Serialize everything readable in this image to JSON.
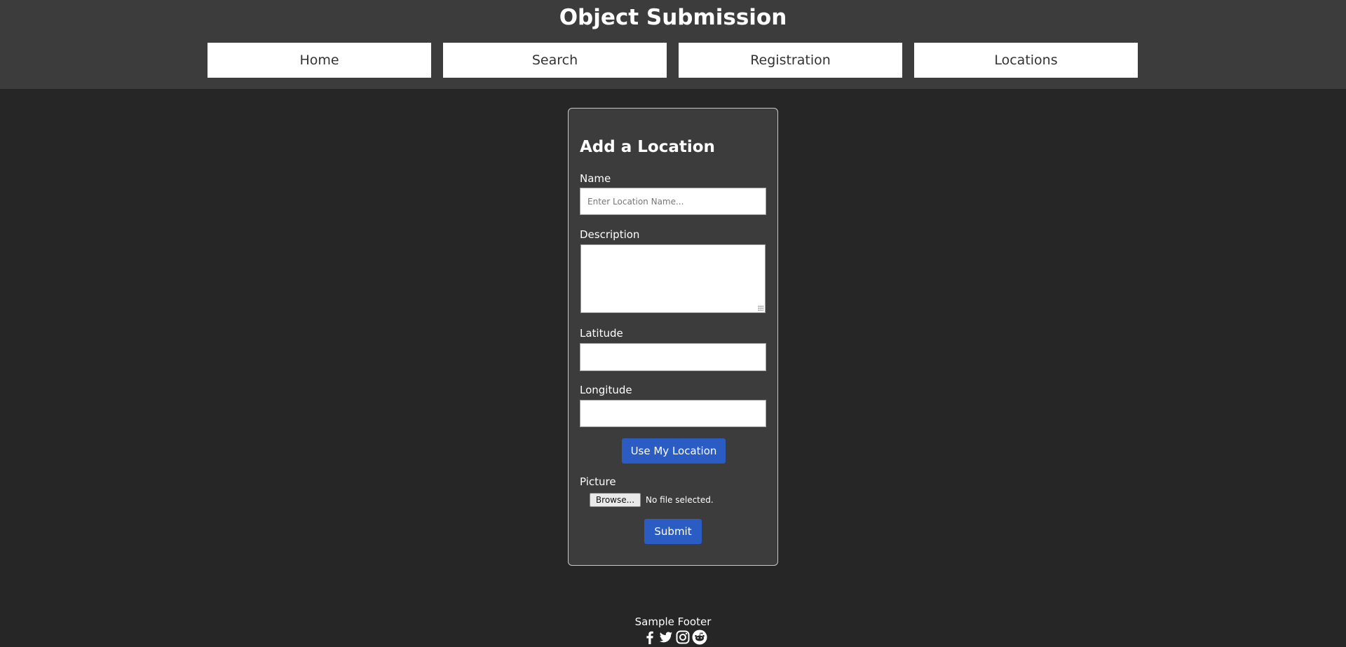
{
  "header": {
    "title": "Object Submission",
    "nav": [
      {
        "label": "Home"
      },
      {
        "label": "Search"
      },
      {
        "label": "Registration"
      },
      {
        "label": "Locations"
      }
    ]
  },
  "form": {
    "title": "Add a Location",
    "name": {
      "label": "Name",
      "placeholder": "Enter Location Name...",
      "value": ""
    },
    "description": {
      "label": "Description",
      "value": ""
    },
    "latitude": {
      "label": "Latitude",
      "value": ""
    },
    "longitude": {
      "label": "Longitude",
      "value": ""
    },
    "use_location_label": "Use My Location",
    "picture": {
      "label": "Picture",
      "browse_label": "Browse...",
      "status": "No file selected."
    },
    "submit_label": "Submit"
  },
  "footer": {
    "text": "Sample Footer",
    "icons": [
      "facebook-icon",
      "twitter-icon",
      "instagram-icon",
      "reddit-icon"
    ]
  },
  "colors": {
    "page_background": "#262626",
    "header_background": "#3c3c3c",
    "card_background": "#3c3c3c",
    "button_accent": "#2a5cc4"
  }
}
